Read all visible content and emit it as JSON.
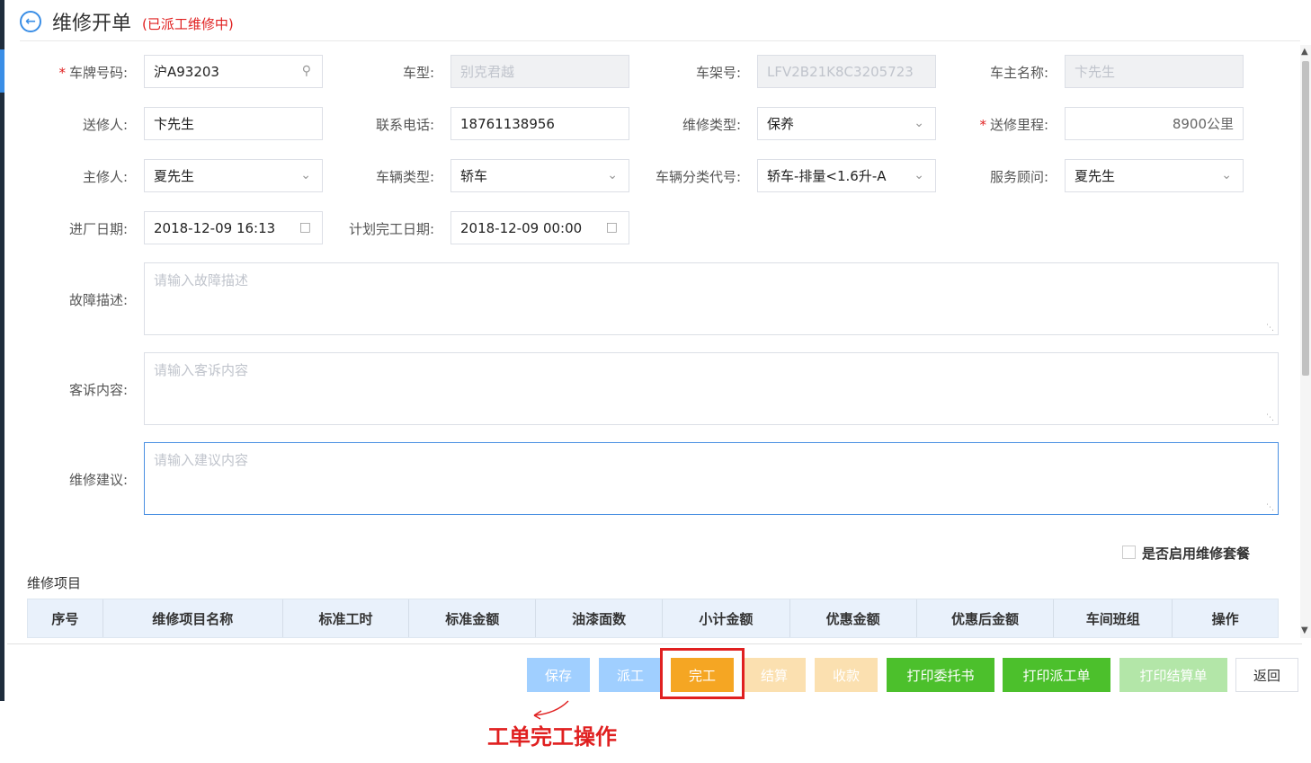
{
  "header": {
    "back_icon": "arrow-left-circle-icon",
    "title": "维修开单",
    "status": "(已派工维修中)"
  },
  "form": {
    "plate": {
      "label": "车牌号码:",
      "value": "沪A93203"
    },
    "model": {
      "label": "车型:",
      "value": "别克君越"
    },
    "vin": {
      "label": "车架号:",
      "value": "LFV2B21K8C3205723"
    },
    "owner": {
      "label": "车主名称:",
      "value": "卞先生"
    },
    "sender": {
      "label": "送修人:",
      "value": "卞先生"
    },
    "phone": {
      "label": "联系电话:",
      "value": "18761138956"
    },
    "repair_type": {
      "label": "维修类型:",
      "value": "保养"
    },
    "mileage": {
      "label": "送修里程:",
      "value": "8900公里"
    },
    "mechanic": {
      "label": "主修人:",
      "value": "夏先生"
    },
    "vehicle_type": {
      "label": "车辆类型:",
      "value": "轿车"
    },
    "vehicle_class": {
      "label": "车辆分类代号:",
      "value": "轿车-排量<1.6升-A"
    },
    "advisor": {
      "label": "服务顾问:",
      "value": "夏先生"
    },
    "entry_date": {
      "label": "进厂日期:",
      "value": "2018-12-09 16:13"
    },
    "plan_date": {
      "label": "计划完工日期:",
      "value": "2018-12-09 00:00"
    },
    "fault": {
      "label": "故障描述:",
      "placeholder": "请输入故障描述"
    },
    "complaint": {
      "label": "客诉内容:",
      "placeholder": "请输入客诉内容"
    },
    "advice": {
      "label": "维修建议:",
      "placeholder": "请输入建议内容"
    },
    "required_mark": "*"
  },
  "package_checkbox": {
    "label": "是否启用维修套餐",
    "checked": false
  },
  "items": {
    "title": "维修项目",
    "columns": [
      "序号",
      "维修项目名称",
      "标准工时",
      "标准金额",
      "油漆面数",
      "小计金额",
      "优惠金额",
      "优惠后金额",
      "车间班组",
      "操作"
    ]
  },
  "buttons": [
    {
      "label": "保存",
      "color": "#a0cfff"
    },
    {
      "label": "派工",
      "color": "#a0cfff"
    },
    {
      "label": "完工",
      "color": "#f5a623"
    },
    {
      "label": "结算",
      "color": "#fbe0b0"
    },
    {
      "label": "收款",
      "color": "#fbe0b0"
    },
    {
      "label": "打印委托书",
      "color": "#4cc02c"
    },
    {
      "label": "打印派工单",
      "color": "#4cc02c"
    },
    {
      "label": "打印结算单",
      "color": "#b3e6a8"
    },
    {
      "label": "返回",
      "color": "#ffffff"
    }
  ],
  "annotation": {
    "text": "工单完工操作"
  }
}
